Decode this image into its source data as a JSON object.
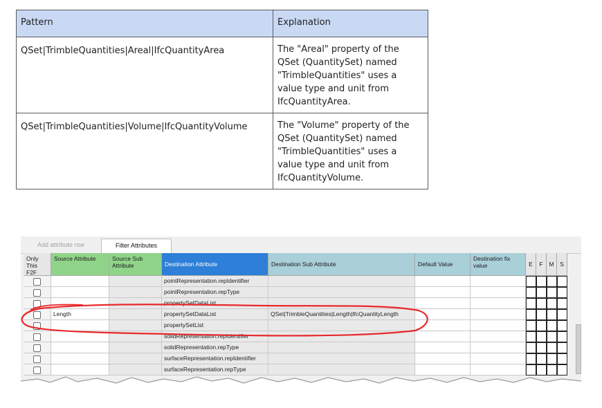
{
  "doc_table": {
    "headers": [
      "Pattern",
      "Explanation"
    ],
    "rows": [
      {
        "pattern": "QSet|TrimbleQuantities|Areal|IfcQuantityArea",
        "explanation": "The \"Areal\" property of the QSet (QuantitySet) named \"TrimbleQuantities\" uses a value type and unit from IfcQuantityArea."
      },
      {
        "pattern": "QSet|TrimbleQuantities|Volume|IfcQuantityVolume",
        "explanation": "The \"Volume\" property of the QSet (QuantitySet) named \"TrimbleQuantities\" uses a value type and unit from IfcQuantityVolume."
      }
    ]
  },
  "toolbar": {
    "add_label": "Add attribute row",
    "filter_label": "Filter Attributes"
  },
  "grid": {
    "headers": {
      "only": "Only This F2F",
      "source": "Source Attribute",
      "source_sub": "Source Sub Attribute",
      "destination": "Destination Attribute",
      "destination_sub": "Destination Sub Attribute",
      "default": "Default Value",
      "fix": "Destination fix value",
      "e": "E",
      "f": "F",
      "m": "M",
      "s": "S"
    },
    "rows": [
      {
        "source": "",
        "destination": "pointRepresentation.repIdentifier",
        "destination_sub": ""
      },
      {
        "source": "",
        "destination": "pointRepresentation.repType",
        "destination_sub": ""
      },
      {
        "source": "",
        "destination": "propertySetDataList",
        "destination_sub": ""
      },
      {
        "source": "Length",
        "destination": "propertySetDataList",
        "destination_sub": "QSet|TrimbleQuantities|Length|IfcQuantityLength"
      },
      {
        "source": "",
        "destination": "propertySetList",
        "destination_sub": ""
      },
      {
        "source": "",
        "destination": "solidRepresentation.repIdentifier",
        "destination_sub": ""
      },
      {
        "source": "",
        "destination": "solidRepresentation.repType",
        "destination_sub": ""
      },
      {
        "source": "",
        "destination": "surfaceRepresentation.repIdentifier",
        "destination_sub": ""
      },
      {
        "source": "",
        "destination": "surfaceRepresentation.repType",
        "destination_sub": ""
      }
    ]
  },
  "colors": {
    "doc_header": "#c9d9f4",
    "source_header": "#90d48a",
    "destination_header": "#2e7fd8",
    "sub_header": "#a9cfd9",
    "highlight": "#e8272b"
  }
}
